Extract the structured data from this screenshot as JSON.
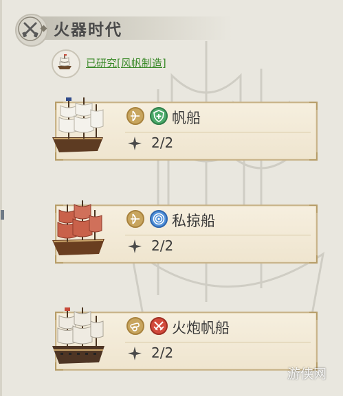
{
  "header": {
    "title": "火器时代",
    "emblem_icon": "crossed-pistols-icon"
  },
  "research": {
    "text": "已研究[风帆制造]",
    "icon": "ship-icon",
    "color": "#3b8a2a"
  },
  "units": [
    {
      "name": "帆船",
      "type_icon": "bow-class-icon",
      "ability_icon": "shield-plus-icon",
      "ability_color": "#4caa6a",
      "count": "2/2"
    },
    {
      "name": "私掠船",
      "type_icon": "bow-class-icon",
      "ability_icon": "spiral-icon",
      "ability_color": "#4f8fd8",
      "count": "2/2"
    },
    {
      "name": "火炮帆船",
      "type_icon": "cannon-class-icon",
      "ability_icon": "crossed-swords-icon",
      "ability_color": "#d24a3c",
      "count": "2/2"
    }
  ],
  "watermark": "游侠网"
}
